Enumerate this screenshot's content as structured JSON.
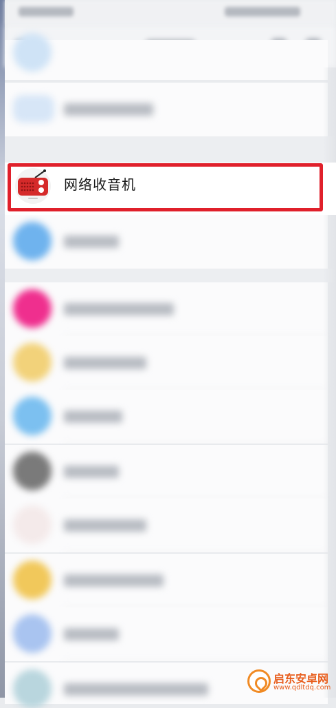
{
  "highlighted_item": {
    "label": "网络收音机",
    "icon": "radio-icon"
  },
  "blurred_list": [
    {
      "icon_color": "#cfe3f6"
    },
    {
      "icon_color": "#6fb3ee"
    },
    {
      "icon_color": "#ef2f8e"
    },
    {
      "icon_color": "#f2d27a"
    },
    {
      "icon_color": "#7cc0f0"
    },
    {
      "icon_color": "#7a7a7a"
    },
    {
      "icon_color": "#f4eaea"
    },
    {
      "icon_color": "#f1c85b"
    },
    {
      "icon_color": "#a9c4f0"
    },
    {
      "icon_color": "#b9d6de"
    }
  ],
  "colors": {
    "highlight_border": "#e0202b",
    "radio_red": "#d52a2a"
  },
  "watermark": {
    "title": "启东安卓网",
    "url": "www.qdltdq.com"
  }
}
